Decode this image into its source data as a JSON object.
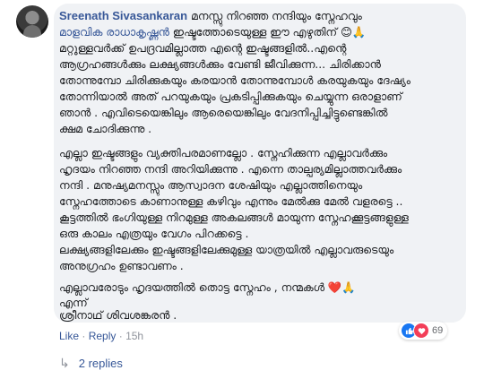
{
  "comment": {
    "author": "Sreenath Sivasankaran",
    "line1_text": "മനസ്സു നിറഞ്ഞ നന്ദിയും സ്നേഹവും",
    "mention": "മാളവിക രാധാകൃഷ്ണൻ",
    "line2_text": "ഇഷ്ടത്തോടെയുള്ള ഈ എഴുതിന്",
    "line2_emoji": "😊🙏",
    "paragraph1": [
      "മറ്റുള്ളവർക്ക് ഉപദ്രവമില്ലാത്ത എന്റെ ഇഷ്ടങ്ങളിൽ..എന്റെ",
      "ആഗ്രഹങ്ങൾക്കും ലക്ഷ്യങ്ങൾക്കും വേണ്ടി ജീവിക്കുന്ന... ചിരിക്കാൻ",
      "തോന്നുമ്പോ ചിരിക്കുകയും കരയാൻ തോന്നുമ്പോൾ കരയുകയും ദേഷ്യം",
      "തോന്നിയാൽ അത് പറയുകയും പ്രകടിപ്പിക്കുകയും ചെയ്യുന്ന ഒരാളാണ്",
      "ഞാൻ . എവിടെയെങ്കിലും ആരെയെങ്കിലും വേദനിപ്പിച്ചിട്ടുണ്ടെങ്കിൽ",
      "ക്ഷമ ചോദിക്കുന്നു ."
    ],
    "paragraph2": [
      "എല്ലാ ഇഷ്ടങ്ങളും വ്യക്തിപരമാണല്ലോ . സ്നേഹിക്കുന്ന എല്ലാവർക്കും",
      "ഹൃദയം നിറഞ്ഞ നന്ദി അറിയിക്കുന്നു . എന്നെ താല്പര്യമില്ലാത്തവർക്കും",
      "നന്ദി . മനുഷ്യമനസ്സും ആസ്വാദന ശേഷിയും എല്ലാത്തിനെയും",
      "സ്നേഹത്തോടെ കാണാനുള്ള കഴിവും എന്നും മേൽക്കു മേൽ വളരട്ടെ ..",
      "കൂട്ടത്തിൽ ഭംഗിയുള്ള നിറമുള്ള അകലങ്ങൾ മായുന്ന സ്നേഹക്കൂട്ടങ്ങളുള്ള",
      "ഒരു കാലം എത്രയും വേഗം പിറക്കട്ടെ .",
      "ലക്ഷ്യങ്ങളിലേക്കും ഇഷ്ടങ്ങളിലേക്കുമുള്ള യാത്രയിൽ എല്ലാവരുടെയും",
      "അനുഗ്രഹം ഉണ്ടാവണം ."
    ],
    "closing_text": "എല്ലാവരോടും ഹൃദയത്തിൽ തൊട്ട സ്നേഹം , നന്മകൾ",
    "closing_emoji": "❤️🙏",
    "sign_word": "എന്ന്",
    "signature": "ശ്രീനാഥ് ശിവശങ്കരൻ ."
  },
  "reactions": {
    "like_icon": "like-icon",
    "love_icon": "love-icon",
    "count": "69"
  },
  "actions": {
    "like": "Like",
    "separator": "·",
    "reply": "Reply",
    "time": "15h"
  },
  "replies": {
    "arrow": "↳",
    "label": "2 replies"
  }
}
